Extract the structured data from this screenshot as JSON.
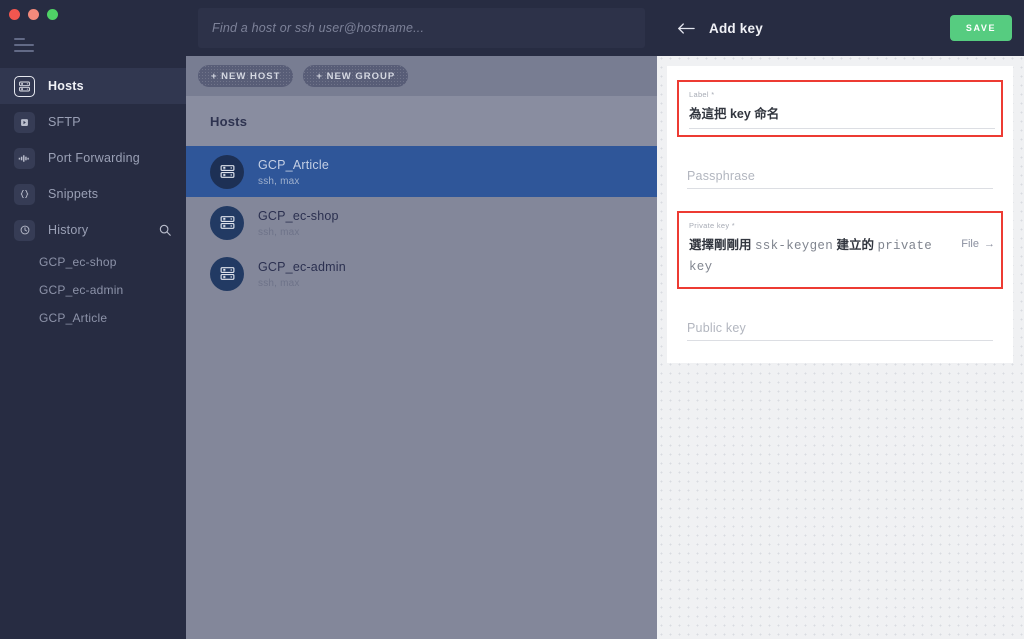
{
  "window": {
    "traffic_lights": [
      "close",
      "minimize",
      "zoom"
    ]
  },
  "sidebar": {
    "menu_icon": "hamburger-icon",
    "items": [
      {
        "label": "Hosts",
        "icon": "server-rack-icon",
        "active": true
      },
      {
        "label": "SFTP",
        "icon": "file-transfer-icon",
        "active": false
      },
      {
        "label": "Port Forwarding",
        "icon": "port-forwarding-icon",
        "active": false
      },
      {
        "label": "Snippets",
        "icon": "braces-icon",
        "active": false
      },
      {
        "label": "History",
        "icon": "clock-icon",
        "active": false,
        "search_icon": "search-icon"
      }
    ],
    "history_items": [
      "GCP_ec-shop",
      "GCP_ec-admin",
      "GCP_Article"
    ]
  },
  "search": {
    "placeholder": "Find a host or ssh user@hostname..."
  },
  "toolbar": {
    "new_host_label": "+ NEW HOST",
    "new_group_label": "+ NEW GROUP"
  },
  "host_list": {
    "header": "Hosts",
    "rows": [
      {
        "name": "GCP_Article",
        "sub": "ssh, max",
        "selected": true
      },
      {
        "name": "GCP_ec-shop",
        "sub": "ssh, max",
        "selected": false
      },
      {
        "name": "GCP_ec-admin",
        "sub": "ssh, max",
        "selected": false
      }
    ]
  },
  "panel": {
    "back_icon": "back-arrow-icon",
    "title": "Add key",
    "save_label": "SAVE",
    "fields": {
      "label": {
        "label": "Label *",
        "value": "為這把 key 命名",
        "highlighted": true
      },
      "passphrase": {
        "placeholder": "Passphrase",
        "highlighted": false
      },
      "private_key": {
        "label": "Private key *",
        "value_prefix": "選擇剛剛用 ",
        "value_mono": "ssk-keygen",
        "value_mid": " 建立的 ",
        "value_mono2": "private key",
        "file_label": "File",
        "file_arrow": "→",
        "highlighted": true
      },
      "public_key": {
        "placeholder": "Public key",
        "highlighted": false
      }
    }
  },
  "colors": {
    "accent_green": "#56cc80",
    "highlight_red": "#ed3b33",
    "selected_blue": "#2f5699",
    "sidebar_dark": "#272c42"
  }
}
